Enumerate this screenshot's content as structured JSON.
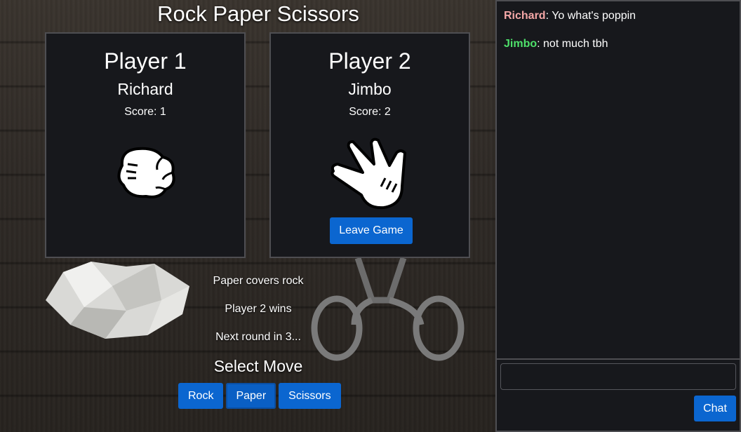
{
  "app": {
    "title": "Rock Paper Scissors"
  },
  "players": [
    {
      "title": "Player 1",
      "name": "Richard",
      "score": "Score: 1",
      "move_icon": "rock-hand-icon"
    },
    {
      "title": "Player 2",
      "name": "Jimbo",
      "score": "Score: 2",
      "move_icon": "paper-hand-icon"
    }
  ],
  "leave_button": "Leave Game",
  "result": {
    "line1": "Paper covers rock",
    "line2": "Player 2 wins",
    "line3": "Next round in 3..."
  },
  "select_move": {
    "title": "Select Move",
    "options": [
      "Rock",
      "Paper",
      "Scissors"
    ],
    "selected": "Paper"
  },
  "chat": {
    "messages": [
      {
        "user": "Richard",
        "sep": ":",
        "text": " Yo what's poppin",
        "color": "#f4a7a7"
      },
      {
        "user": "Jimbo",
        "sep": ":",
        "text": " not much tbh",
        "color": "#4ee06a"
      }
    ],
    "input": {
      "value": "",
      "placeholder": ""
    },
    "send_label": "Chat"
  },
  "colors": {
    "accent": "#0b66d0",
    "panel": "#17181c",
    "border": "#4e4e52"
  }
}
